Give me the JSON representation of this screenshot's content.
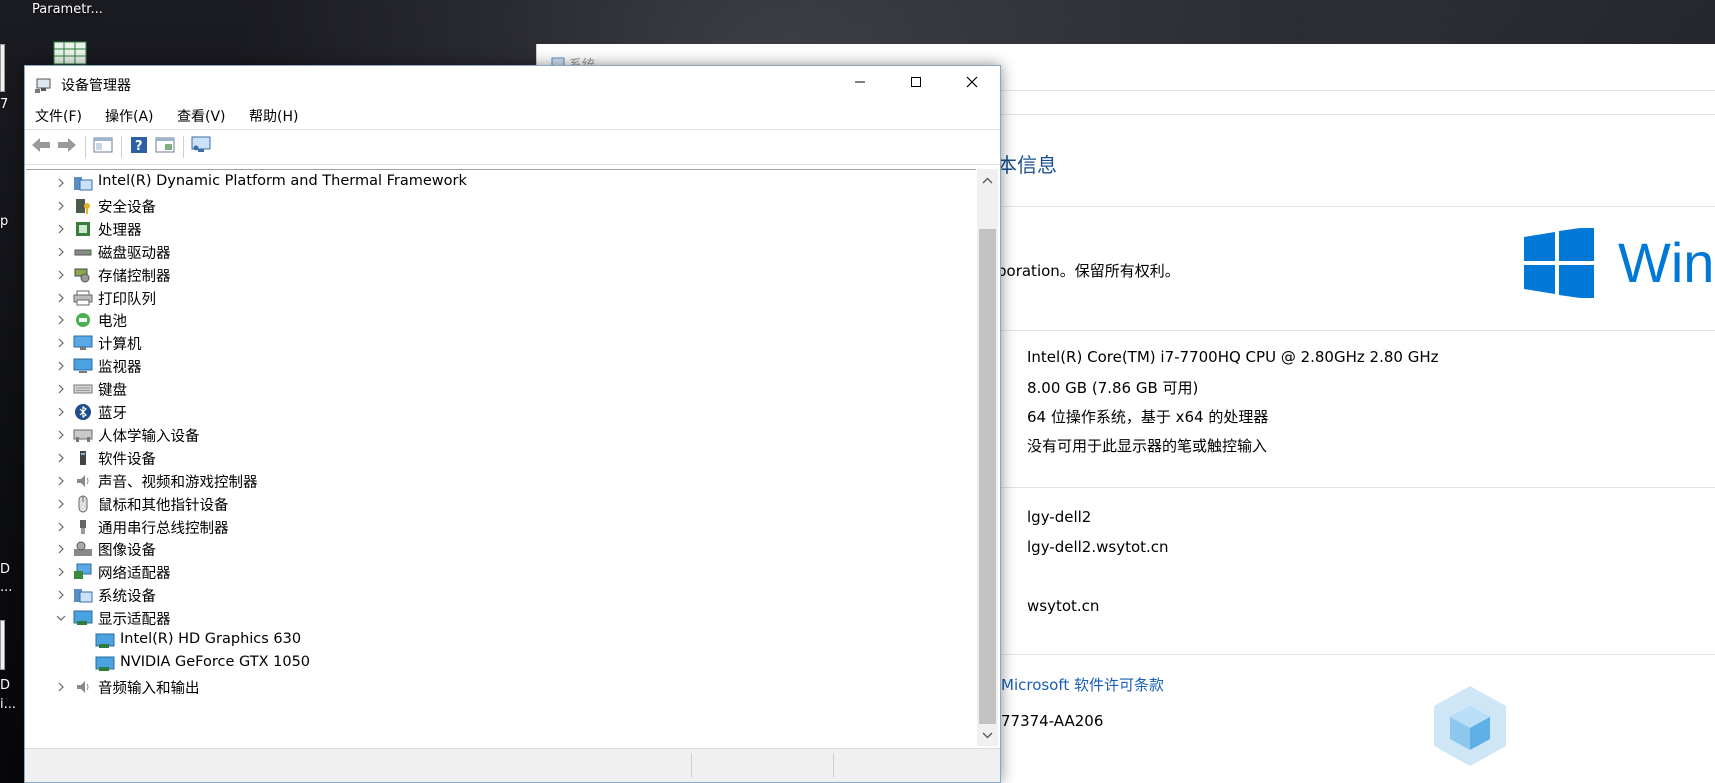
{
  "desktop": {
    "icon_label_top": "Parametr...",
    "edge_fragments": [
      "7",
      "p",
      "D",
      "...",
      "D",
      "i..."
    ]
  },
  "system_window": {
    "title": "系统",
    "section_heading": "本信息",
    "copyright_text": "poration。保留所有权利。",
    "windows_wordmark": "Win",
    "specs": [
      "Intel(R) Core(TM) i7-7700HQ CPU @ 2.80GHz   2.80 GHz",
      "8.00 GB (7.86 GB 可用)",
      "64 位操作系统，基于 x64 的处理器",
      "没有可用于此显示器的笔或触控输入"
    ],
    "computer_name": "lgy-dell2",
    "full_computer_name": "lgy-dell2.wsytot.cn",
    "domain": "wsytot.cn",
    "license_link": "Microsoft 软件许可条款",
    "product_id_fragment": "77374-AA206"
  },
  "device_manager": {
    "title": "设备管理器",
    "menu": [
      "文件(F)",
      "操作(A)",
      "查看(V)",
      "帮助(H)"
    ],
    "tree": [
      {
        "label": "Intel(R) Dynamic Platform and Thermal Framework",
        "icon": "platform-icon",
        "expanded": false,
        "level": 0
      },
      {
        "label": "安全设备",
        "icon": "security-device-icon",
        "expanded": false,
        "level": 0
      },
      {
        "label": "处理器",
        "icon": "processor-icon",
        "expanded": false,
        "level": 0
      },
      {
        "label": "磁盘驱动器",
        "icon": "disk-drive-icon",
        "expanded": false,
        "level": 0
      },
      {
        "label": "存储控制器",
        "icon": "storage-controller-icon",
        "expanded": false,
        "level": 0
      },
      {
        "label": "打印队列",
        "icon": "printer-icon",
        "expanded": false,
        "level": 0
      },
      {
        "label": "电池",
        "icon": "battery-icon",
        "expanded": false,
        "level": 0
      },
      {
        "label": "计算机",
        "icon": "computer-icon",
        "expanded": false,
        "level": 0
      },
      {
        "label": "监视器",
        "icon": "monitor-icon",
        "expanded": false,
        "level": 0
      },
      {
        "label": "键盘",
        "icon": "keyboard-icon",
        "expanded": false,
        "level": 0
      },
      {
        "label": "蓝牙",
        "icon": "bluetooth-icon",
        "expanded": false,
        "level": 0
      },
      {
        "label": "人体学输入设备",
        "icon": "hid-icon",
        "expanded": false,
        "level": 0
      },
      {
        "label": "软件设备",
        "icon": "software-device-icon",
        "expanded": false,
        "level": 0
      },
      {
        "label": "声音、视频和游戏控制器",
        "icon": "speaker-icon",
        "expanded": false,
        "level": 0
      },
      {
        "label": "鼠标和其他指针设备",
        "icon": "mouse-icon",
        "expanded": false,
        "level": 0
      },
      {
        "label": "通用串行总线控制器",
        "icon": "usb-icon",
        "expanded": false,
        "level": 0
      },
      {
        "label": "图像设备",
        "icon": "camera-icon",
        "expanded": false,
        "level": 0
      },
      {
        "label": "网络适配器",
        "icon": "network-adapter-icon",
        "expanded": false,
        "level": 0
      },
      {
        "label": "系统设备",
        "icon": "system-device-icon",
        "expanded": false,
        "level": 0
      },
      {
        "label": "显示适配器",
        "icon": "display-adapter-icon",
        "expanded": true,
        "level": 0
      },
      {
        "label": "Intel(R) HD Graphics 630",
        "icon": "display-adapter-icon",
        "expanded": null,
        "level": 1
      },
      {
        "label": "NVIDIA GeForce GTX 1050",
        "icon": "display-adapter-icon",
        "expanded": null,
        "level": 1
      },
      {
        "label": "音频输入和输出",
        "icon": "speaker-icon",
        "expanded": false,
        "level": 0
      }
    ]
  }
}
